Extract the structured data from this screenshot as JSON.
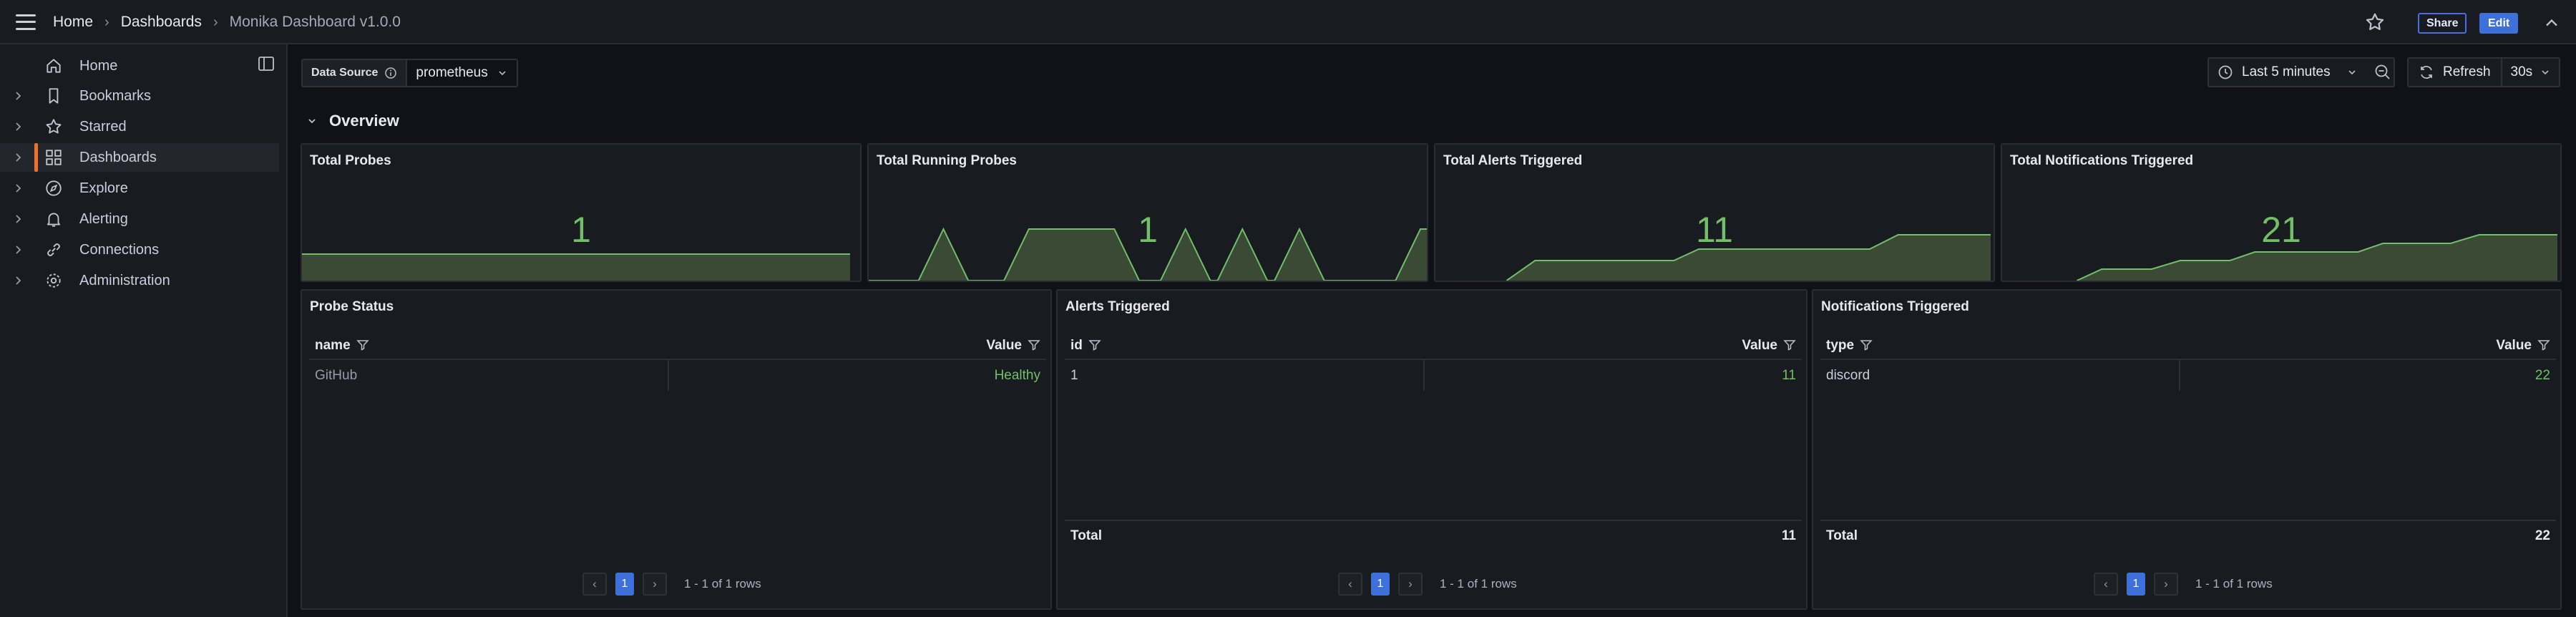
{
  "header": {
    "breadcrumb": [
      "Home",
      "Dashboards",
      "Monika Dashboard v1.0.0"
    ],
    "share_label": "Share",
    "edit_label": "Edit"
  },
  "sidebar": {
    "items": [
      {
        "label": "Home",
        "icon": "home-icon",
        "expandable": false,
        "active": false
      },
      {
        "label": "Bookmarks",
        "icon": "bookmark-icon",
        "expandable": true,
        "active": false
      },
      {
        "label": "Starred",
        "icon": "star-icon",
        "expandable": true,
        "active": false
      },
      {
        "label": "Dashboards",
        "icon": "apps-grid-icon",
        "expandable": true,
        "active": true
      },
      {
        "label": "Explore",
        "icon": "compass-icon",
        "expandable": true,
        "active": false
      },
      {
        "label": "Alerting",
        "icon": "bell-icon",
        "expandable": true,
        "active": false
      },
      {
        "label": "Connections",
        "icon": "link-icon",
        "expandable": true,
        "active": false
      },
      {
        "label": "Administration",
        "icon": "cog-icon",
        "expandable": true,
        "active": false
      }
    ]
  },
  "toolbar": {
    "data_source_label": "Data Source",
    "data_source_value": "prometheus",
    "time_range": "Last 5 minutes",
    "refresh_label": "Refresh",
    "refresh_interval": "30s"
  },
  "row": {
    "title": "Overview"
  },
  "stats": [
    {
      "title": "Total Probes",
      "value": "1"
    },
    {
      "title": "Total Running Probes",
      "value": "1"
    },
    {
      "title": "Total Alerts Triggered",
      "value": "11"
    },
    {
      "title": "Total Notifications Triggered",
      "value": "21"
    }
  ],
  "tables": {
    "probe_status": {
      "title": "Probe Status",
      "columns": [
        "name",
        "Value"
      ],
      "rows": [
        [
          "GitHub",
          "Healthy"
        ]
      ],
      "page": "1",
      "rows_text": "1 - 1 of 1 rows"
    },
    "alerts": {
      "title": "Alerts Triggered",
      "columns": [
        "id",
        "Value"
      ],
      "rows": [
        [
          "1",
          "11"
        ]
      ],
      "total_label": "Total",
      "total_value": "11",
      "page": "1",
      "rows_text": "1 - 1 of 1 rows"
    },
    "notifications": {
      "title": "Notifications Triggered",
      "columns": [
        "type",
        "Value"
      ],
      "rows": [
        [
          "discord",
          "22"
        ]
      ],
      "total_label": "Total",
      "total_value": "22",
      "page": "1",
      "rows_text": "1 - 1 of 1 rows"
    }
  },
  "colors": {
    "accent": "#3d71d9",
    "stat_green": "#73bf69",
    "sidebar_active": "#f0712a"
  }
}
